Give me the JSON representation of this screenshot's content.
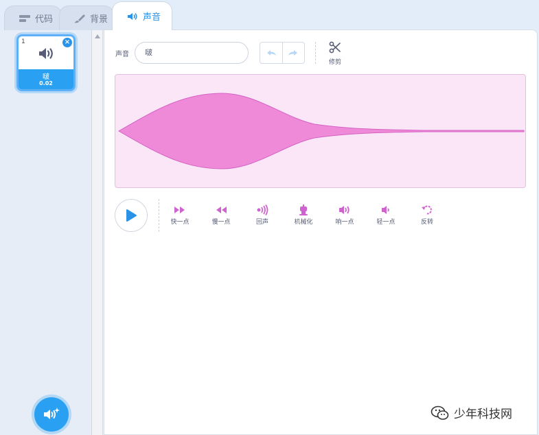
{
  "tabs": [
    {
      "label": "代码",
      "icon": "code-icon",
      "active": false
    },
    {
      "label": "背景",
      "icon": "brush-icon",
      "active": false
    },
    {
      "label": "声音",
      "icon": "speaker-icon",
      "active": true
    }
  ],
  "sound_list": {
    "items": [
      {
        "index": "1",
        "name": "啵",
        "duration": "0.02"
      }
    ]
  },
  "editor": {
    "sound_label": "声音",
    "sound_name_value": "啵",
    "trim_label": "修剪",
    "effects": [
      {
        "label": "快一点",
        "icon": "faster-icon"
      },
      {
        "label": "慢一点",
        "icon": "slower-icon"
      },
      {
        "label": "回声",
        "icon": "echo-icon"
      },
      {
        "label": "机械化",
        "icon": "robot-icon"
      },
      {
        "label": "响一点",
        "icon": "louder-icon"
      },
      {
        "label": "轻一点",
        "icon": "softer-icon"
      },
      {
        "label": "反转",
        "icon": "reverse-icon"
      }
    ]
  },
  "watermark": {
    "text": "少年科技网",
    "icon": "wechat-icon"
  },
  "colors": {
    "accent": "#2aa0f3",
    "waveform_fill": "#ef8ad9",
    "waveform_bg": "#fae6f6",
    "effect_icon": "#cf63cf"
  }
}
